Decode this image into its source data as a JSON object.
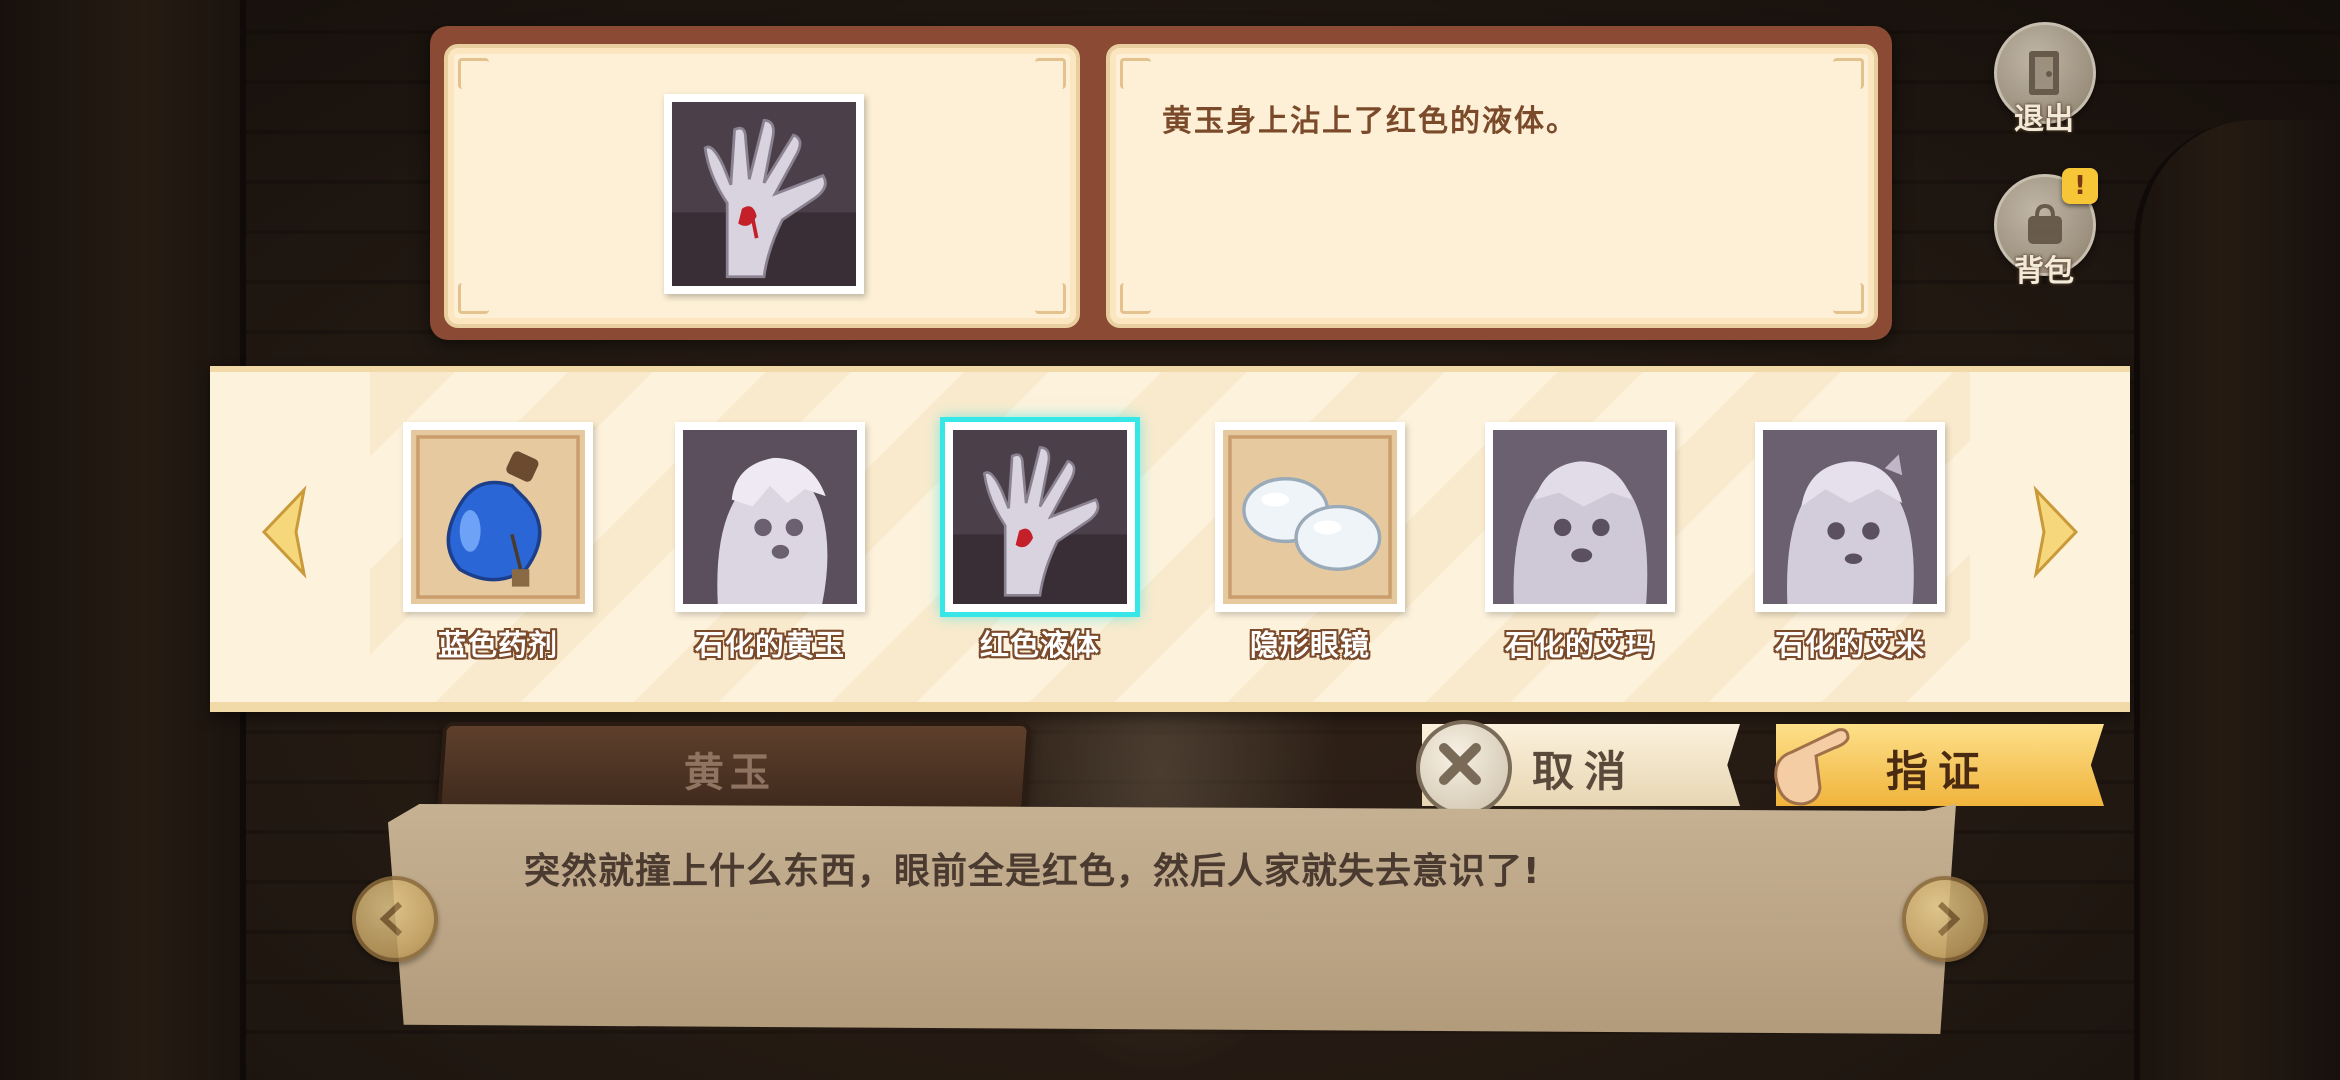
{
  "top_panel": {
    "selected_description": "黄玉身上沾上了红色的液体。"
  },
  "side_buttons": {
    "exit_label": "退出",
    "bag_label": "背包",
    "bag_badge": "!"
  },
  "inventory": {
    "items": [
      {
        "name": "蓝色药剂",
        "icon": "blue-potion-icon"
      },
      {
        "name": "石化的黄玉",
        "icon": "petrified-character-portrait"
      },
      {
        "name": "红色液体",
        "icon": "bloody-hand-image",
        "selected": true
      },
      {
        "name": "隐形眼镜",
        "icon": "contact-lens-icon"
      },
      {
        "name": "石化的艾玛",
        "icon": "petrified-character-portrait"
      },
      {
        "name": "石化的艾米",
        "icon": "petrified-character-portrait"
      }
    ]
  },
  "actions": {
    "cancel_label": "取消",
    "confirm_label": "指证"
  },
  "dialog": {
    "speaker": "黄玉",
    "text": "突然就撞上什么东西，眼前全是红色，然后人家就失去意识了!"
  },
  "colors": {
    "selection_glow": "#37e6e6",
    "panel_frame": "#8b4a34",
    "card_bg": "#fdf0d6",
    "confirm_button": "#f0b43c"
  }
}
